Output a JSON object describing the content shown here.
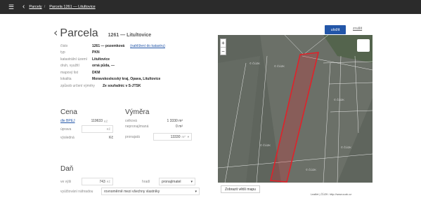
{
  "topbar": {
    "crumb_parcels": "Parcely",
    "separator": "/",
    "crumb_current": "Parcela 1261 — Litultovice",
    "menu_icon": "hamburger-icon",
    "back_icon": "chevron-left-icon"
  },
  "header": {
    "back_glyph": "‹",
    "title": "Parcela",
    "subtitle": "1261 — Litultovice",
    "save_label": "uložit",
    "cancel_label": "zrušit"
  },
  "attributes": [
    {
      "label": "číslo",
      "value": "1261 — pozemková",
      "link": "(nahlížení do katastru)"
    },
    {
      "label": "typ",
      "value": "PKN"
    },
    {
      "label": "katastrální území",
      "value": "Litultovice"
    },
    {
      "label": "druh, využití",
      "value": "orná půda, —"
    },
    {
      "label": "mapový list",
      "value": "DKM"
    },
    {
      "label": "lokalita",
      "value": "Moravskoslezský kraj, Opava, Litultovice"
    },
    {
      "label": "způsob určení výměry",
      "value": "Ze souřadnic v S-JTSK"
    }
  ],
  "cena": {
    "heading": "Cena",
    "bpej_label": "dle BPEJ",
    "bpej_value": "119633",
    "bpej_unit": "Kč",
    "uprava_label": "úprava",
    "uprava_unit": "Kč",
    "vysledna_label": "výsledná",
    "vysledna_unit": "Kč"
  },
  "vymera": {
    "heading": "Výměra",
    "celkova_label": "celková",
    "celkova_value": "1 3330 m²",
    "nepronaj_label": "nepronajímaná",
    "nepronaj_value": "0 m²",
    "pronajata_label": "pronajatá",
    "pronajata_value": "13330",
    "pronajata_unit": "m²"
  },
  "dan": {
    "heading": "Daň",
    "vyse_label": "ve výši",
    "vyse_value": "743",
    "vyse_unit": "Kč",
    "hradi_label": "hradí",
    "hradi_value": "pronajímatel",
    "nahrada_label": "vyúčtování náhradou",
    "nahrada_value": "rovnoměrně mezi všechny vlastníky"
  },
  "map": {
    "zoom_in": "+",
    "zoom_out": "−",
    "show_larger": "Zobrazit větší mapu",
    "attribution": "Leaflet | ČÚZK: http://www.cuzk.cz",
    "parcel_labels": [
      "© ČÚZK",
      "© ČÚZK",
      "© ČÚZK",
      "© ČÚZK",
      "© ČÚZK",
      "© ČÚZK"
    ],
    "highlight_color": "#e0222a"
  }
}
